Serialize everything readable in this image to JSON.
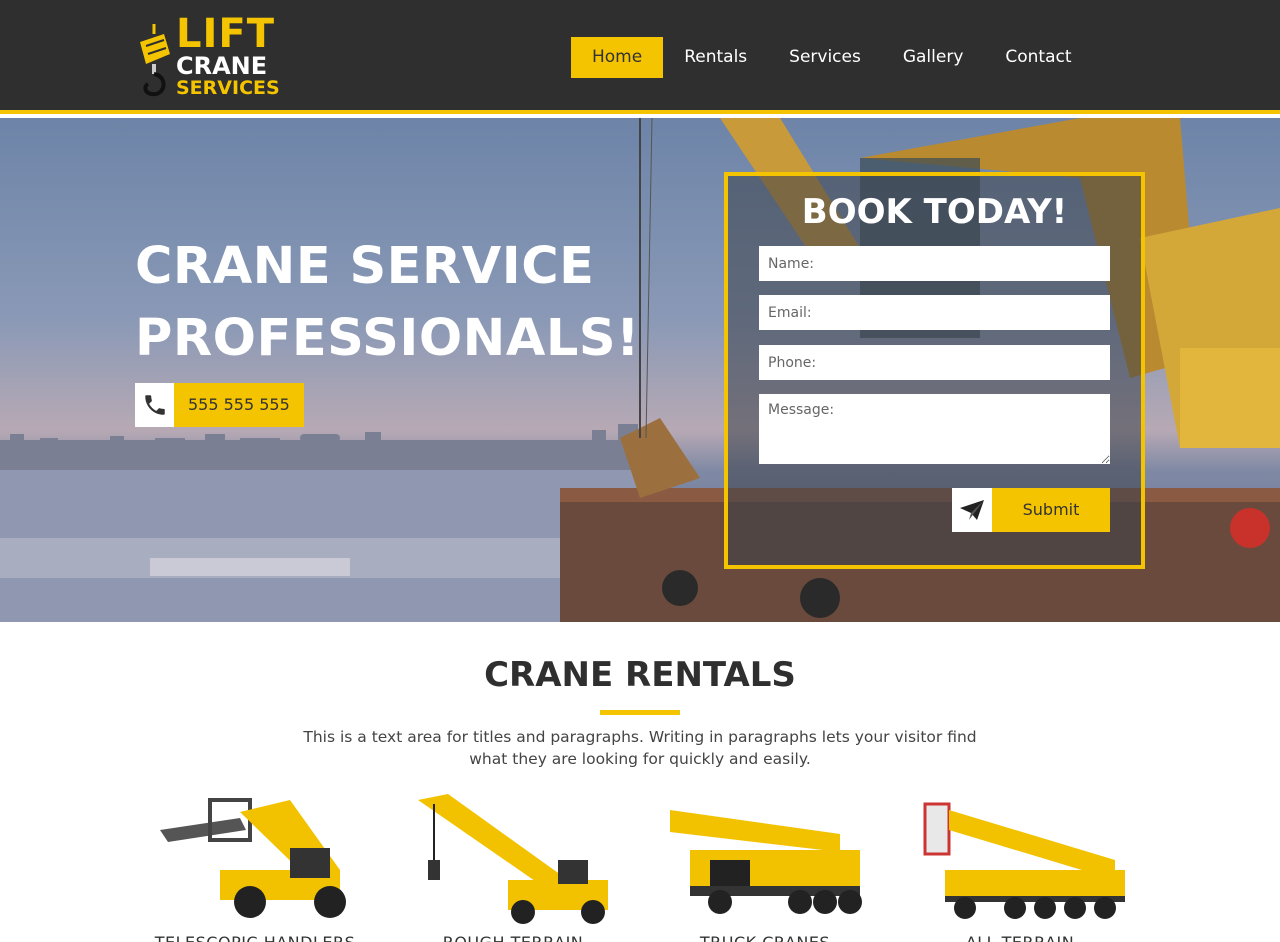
{
  "brand": {
    "line1": "LIFT",
    "line2": "CRANE",
    "line3": "SERVICES"
  },
  "nav": {
    "items": [
      {
        "label": "Home",
        "active": true
      },
      {
        "label": "Rentals",
        "active": false
      },
      {
        "label": "Services",
        "active": false
      },
      {
        "label": "Gallery",
        "active": false
      },
      {
        "label": "Contact",
        "active": false
      }
    ]
  },
  "hero": {
    "title_line1": "CRANE SERVICE",
    "title_line2": "PROFESSIONALS!",
    "phone": "555 555 555"
  },
  "booking": {
    "title": "BOOK TODAY!",
    "name_placeholder": "Name:",
    "email_placeholder": "Email:",
    "phone_placeholder": "Phone:",
    "message_placeholder": "Message:",
    "submit_label": "Submit"
  },
  "rentals": {
    "title": "CRANE RENTALS",
    "description": "This is a text area for titles and paragraphs. Writing in paragraphs lets your visitor find what they are looking for quickly and easily.",
    "items": [
      {
        "label": "TELESCOPIC HANDLERS"
      },
      {
        "label": "ROUGH TERRAIN"
      },
      {
        "label": "TRUCK CRANES"
      },
      {
        "label": "ALL TERRAIN"
      }
    ]
  },
  "colors": {
    "accent": "#f5c400",
    "header_bg": "#2f2f2f"
  },
  "icons": [
    "phone-icon",
    "paper-plane-icon",
    "crane-hook-icon"
  ]
}
